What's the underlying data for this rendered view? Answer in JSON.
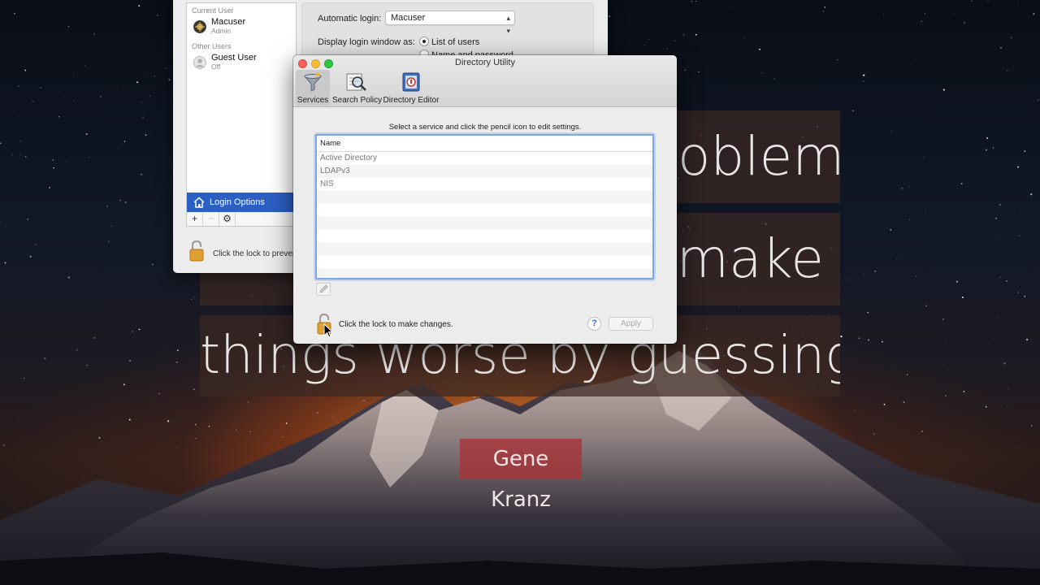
{
  "wallpaper": {
    "quote_line_1": "oblem,",
    "quote_line_2": "pe                                        make",
    "quote_line_3": "things worse by guessing.",
    "author": "Gene Kranz"
  },
  "users_window": {
    "current_user_heading": "Current User",
    "current_user": {
      "name": "Macuser",
      "role": "Admin"
    },
    "other_users_heading": "Other Users",
    "guest_user": {
      "name": "Guest User",
      "role": "Off"
    },
    "login_options_label": "Login Options",
    "tools": {
      "add": "+",
      "remove": "−",
      "gear": "⚙"
    },
    "lock_text": "Click the lock to preven",
    "automatic_login_label": "Automatic login:",
    "automatic_login_value": "Macuser",
    "display_login_label": "Display login window as:",
    "display_options": [
      "List of users",
      "Name and password"
    ]
  },
  "directory_utility": {
    "title": "Directory Utility",
    "toolbar": [
      {
        "label": "Services",
        "icon": "services-icon"
      },
      {
        "label": "Search Policy",
        "icon": "search-policy-icon"
      },
      {
        "label": "Directory Editor",
        "icon": "directory-editor-icon"
      }
    ],
    "instruction": "Select a service and click the pencil icon to edit settings.",
    "table_header": "Name",
    "services": [
      "Active Directory",
      "LDAPv3",
      "NIS"
    ],
    "lock_text": "Click the lock to make changes.",
    "help_label": "?",
    "apply_label": "Apply"
  },
  "colors": {
    "selection_blue": "#2b5fc4",
    "focus_ring": "#7ca6e8",
    "close": "#fc5f57",
    "minimize": "#fdbc2e",
    "maximize": "#2ac940"
  }
}
